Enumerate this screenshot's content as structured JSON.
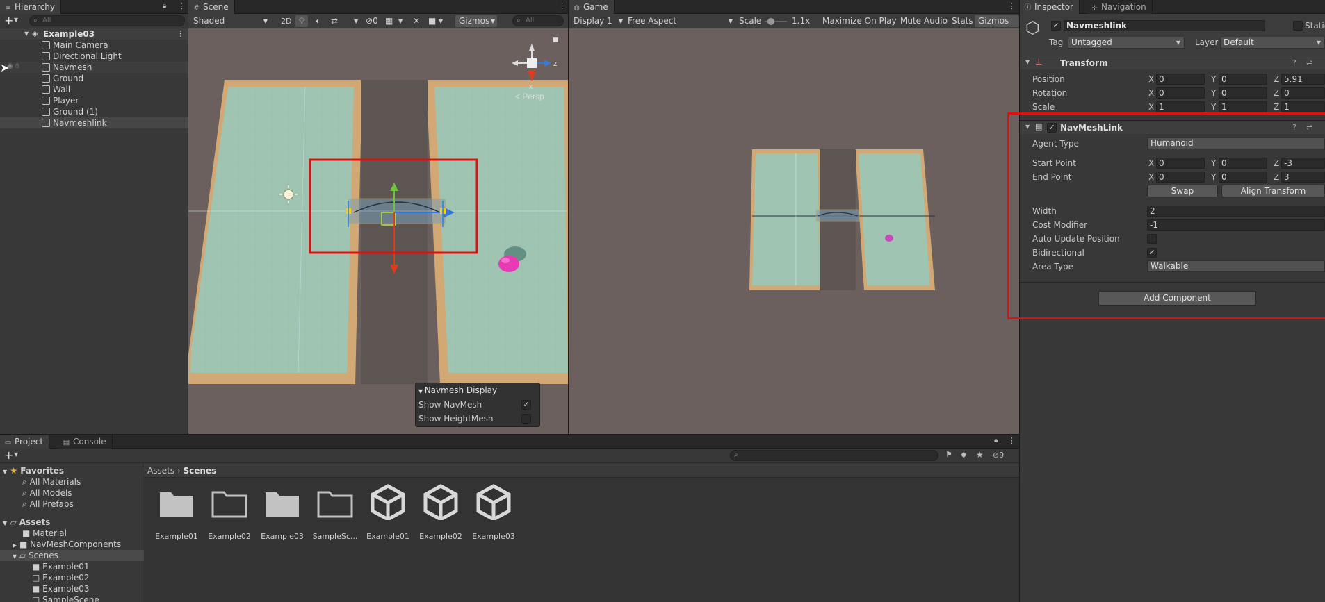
{
  "hierarchy": {
    "tab": "Hierarchy",
    "add_label": "+",
    "search_placeholder": "All",
    "scene_name": "Example03",
    "items": [
      "Main Camera",
      "Directional Light",
      "Navmesh",
      "Ground",
      "Wall",
      "Player",
      "Ground (1)",
      "Navmeshlink"
    ]
  },
  "scene": {
    "tab": "Scene",
    "shading": "Shaded",
    "mode_2d": "2D",
    "hidden_count": "0",
    "gizmos": "Gizmos",
    "search_placeholder": "All",
    "persp_label": "< Persp",
    "axis_z": "z",
    "axis_x": "x",
    "overlay": {
      "title": "Navmesh Display",
      "show_navmesh": "Show NavMesh",
      "show_navmesh_checked": true,
      "show_heightmesh": "Show HeightMesh",
      "show_heightmesh_checked": false
    }
  },
  "game": {
    "tab": "Game",
    "display": "Display 1",
    "aspect": "Free Aspect",
    "scale_label": "Scale",
    "scale_value": "1.1x",
    "maximize": "Maximize On Play",
    "mute": "Mute Audio",
    "stats": "Stats",
    "gizmos": "Gizmos"
  },
  "inspector": {
    "tab": "Inspector",
    "tab2": "Navigation",
    "object_name": "Navmeshlink",
    "static_label": "Static",
    "tag_label": "Tag",
    "tag_value": "Untagged",
    "layer_label": "Layer",
    "layer_value": "Default",
    "transform": {
      "title": "Transform",
      "position_label": "Position",
      "rotation_label": "Rotation",
      "scale_label": "Scale",
      "position": {
        "x": "0",
        "y": "0",
        "z": "5.91"
      },
      "rotation": {
        "x": "0",
        "y": "0",
        "z": "0"
      },
      "scale": {
        "x": "1",
        "y": "1",
        "z": "1"
      }
    },
    "navmeshlink": {
      "title": "NavMeshLink",
      "agent_type_label": "Agent Type",
      "agent_type": "Humanoid",
      "start_label": "Start Point",
      "start": {
        "x": "0",
        "y": "0",
        "z": "-3"
      },
      "end_label": "End Point",
      "end": {
        "x": "0",
        "y": "0",
        "z": "3"
      },
      "swap": "Swap",
      "align": "Align Transform",
      "width_label": "Width",
      "width": "2",
      "cost_label": "Cost Modifier",
      "cost": "-1",
      "auto_update_label": "Auto Update Position",
      "auto_update": false,
      "bidirectional_label": "Bidirectional",
      "bidirectional": true,
      "area_label": "Area Type",
      "area": "Walkable"
    },
    "add_component": "Add Component"
  },
  "project": {
    "tab": "Project",
    "tab2": "Console",
    "add_label": "+",
    "hidden_count": "9",
    "breadcrumb": [
      "Assets",
      "Scenes"
    ],
    "favorites_label": "Favorites",
    "favorites": [
      "All Materials",
      "All Models",
      "All Prefabs"
    ],
    "assets_label": "Assets",
    "tree": [
      "Material",
      "NavMeshComponents",
      "Scenes"
    ],
    "scenes_children": [
      "Example01",
      "Example02",
      "Example03",
      "SampleScene"
    ],
    "grid": [
      {
        "name": "Example01",
        "kind": "folder"
      },
      {
        "name": "Example02",
        "kind": "folder-outline"
      },
      {
        "name": "Example03",
        "kind": "folder"
      },
      {
        "name": "SampleSc...",
        "kind": "folder-outline"
      },
      {
        "name": "Example01",
        "kind": "unity"
      },
      {
        "name": "Example02",
        "kind": "unity"
      },
      {
        "name": "Example03",
        "kind": "unity"
      }
    ]
  },
  "colors": {
    "highlight_red": "#e01010",
    "panel": "#383838",
    "navmesh": "#9fc4b2",
    "ground_frame": "#d2a874"
  }
}
